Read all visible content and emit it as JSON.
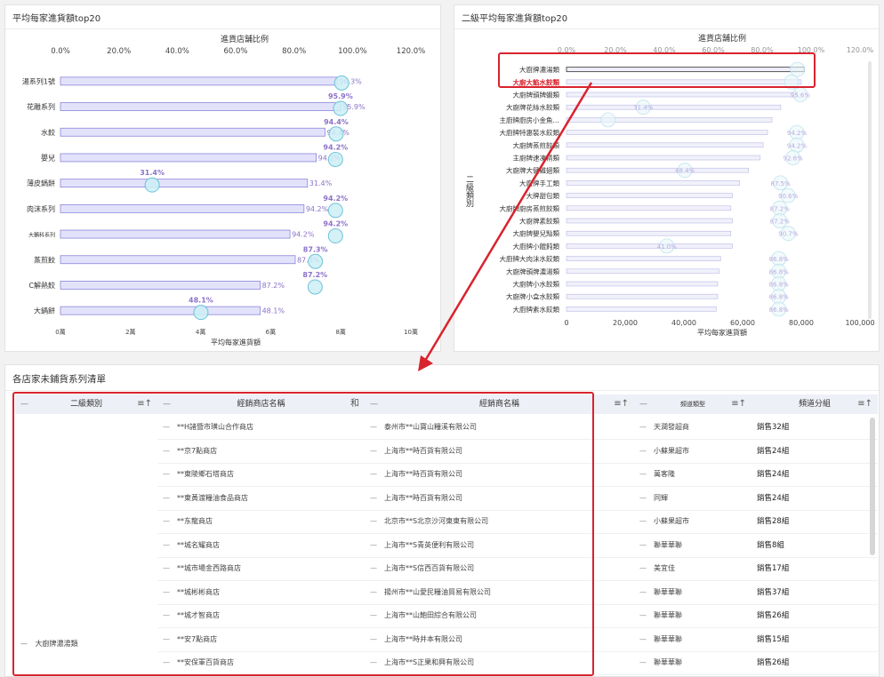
{
  "panel1": {
    "title": "平均每家進貨額top20",
    "top_axis_title": "進貨店舗比例",
    "top_ticks": [
      "0.0%",
      "20.0%",
      "40.0%",
      "60.0%",
      "80.0%",
      "100.0%",
      "120.0%"
    ],
    "bottom_ticks": [
      "0萬",
      "2萬",
      "4萬",
      "6萬",
      "8萬",
      "10萬"
    ],
    "bottom_axis_title": "平均每家進貨額"
  },
  "panel2": {
    "title": "二級平均每家進貨額top20",
    "top_axis_title": "進貨店舗比例",
    "top_ticks": [
      "0.0%",
      "20.0%",
      "40.0%",
      "60.0%",
      "80.0%",
      "100.0%",
      "120.0%"
    ],
    "bottom_ticks": [
      "0",
      "20,000",
      "40,000",
      "60,000",
      "80,000",
      "100,000"
    ],
    "bottom_axis_title": "平均每家進貨額",
    "y_axis_title": "二級類別"
  },
  "chart_data": [
    {
      "type": "bar",
      "title": "平均每家進貨額top20",
      "xlabel": "平均每家進貨額",
      "x2label": "進貨店舗比例",
      "categories": [
        "湯系列1號",
        "花雕系列",
        "水餃",
        "嬰兒",
        "薄皮鍋餅",
        "肉沫系列",
        "大鵝科系列",
        "蒸煎餃",
        "C解熱餃",
        "大鍋餅"
      ],
      "values_wan": [
        7.9,
        8.0,
        7.55,
        7.3,
        7.05,
        6.95,
        6.55,
        6.7,
        5.7,
        5.7
      ],
      "ratio_pct": [
        96.3,
        95.9,
        94.4,
        94.2,
        31.4,
        94.2,
        94.2,
        87.3,
        87.2,
        48.1
      ],
      "bar_labels": [
        "96.3%",
        "95.9%",
        "94.4%",
        "94.2%",
        "31.4%",
        "94.2%",
        "94.2%",
        "87.3%",
        "87.2%",
        "48.1%"
      ],
      "point_labels": [
        "95.9%",
        "94.4%",
        "94.2%",
        "31.4%",
        "94.2%",
        "94.2%",
        "87.3%",
        "87.2%",
        "48.1%"
      ],
      "xlim_wan": [
        0,
        10
      ],
      "x2lim_pct": [
        0,
        120
      ]
    },
    {
      "type": "bar",
      "title": "二級平均每家進貨額top20",
      "xlabel": "平均每家進貨額",
      "x2label": "進貨店舗比例",
      "ylabel": "二級類別",
      "categories": [
        "大廚牌濃湯類",
        "大廚大餡水餃類",
        "大廚牌頭牌蝦類",
        "大廚牌花絲水餃類",
        "主廚牌廚房小金魚…",
        "大廚牌特惠裝水餃類",
        "大廚牌蒸煎餃類",
        "主廚牌速凍精類",
        "大廚牌大健雞翅類",
        "大廚牌手工類",
        "大牌甜包類",
        "大廚牌廚房蒸煎餃類",
        "大廚牌素餃類",
        "大廚牌嬰兒點類",
        "大廚牌小餛飩類",
        "大廚牌大肉沫水餃類",
        "大廚牌頭牌濃湯類",
        "大廚牌小水餃類",
        "大廚牌小盒水餃類",
        "大廚牌素水餃類"
      ],
      "values": [
        81000,
        80000,
        78500,
        73000,
        70000,
        68500,
        67000,
        66000,
        62000,
        59000,
        56500,
        56000,
        56500,
        56000,
        56500,
        52500,
        52000,
        51500,
        51500,
        51000
      ],
      "ratio_pct": [
        94.4,
        92.0,
        95.6,
        31.4,
        17.0,
        94.2,
        94.2,
        92.6,
        48.4,
        87.5,
        90.6,
        87.2,
        87.2,
        90.7,
        41.0,
        86.8,
        86.8,
        86.8,
        86.8,
        86.8
      ],
      "point_labels": [
        "",
        "",
        "95.6%",
        "31.4%",
        "",
        "94.2%",
        "94.2%",
        "92.6%",
        "48.4%",
        "87.5%",
        "90.6%",
        "87.2%",
        "87.2%",
        "90.7%",
        "41.0%",
        "86.8%",
        "86.8%",
        "86.8%",
        "86.8%",
        "86.8%"
      ],
      "xlim": [
        0,
        100000
      ],
      "x2lim_pct": [
        0,
        120
      ]
    }
  ],
  "table": {
    "title": "各店家未鋪貨系列清單",
    "headers": [
      {
        "label": "二級類別",
        "sort": "≡↑"
      },
      {
        "label": "經銷商店名稱",
        "sort": "和"
      },
      {
        "label": "經銷商名稱",
        "sort": "≡↑"
      },
      {
        "label": "頻道類型",
        "sort": "≡↑"
      },
      {
        "label": "頻道分組",
        "sort": "≡↑"
      }
    ],
    "group_value": "大廚牌濃湯類",
    "rows": [
      {
        "store": "**H諸暨市璜山合作商店",
        "dealer": "泰州市**山寶山糧溪有限公司",
        "channel": "天潤發超商",
        "group": "銷售32組"
      },
      {
        "store": "**京7點商店",
        "dealer": "上海市**時百貨有限公司",
        "channel": "小蘇果超市",
        "group": "銷售24組"
      },
      {
        "store": "**東陵鄉石塔商店",
        "dealer": "上海市**時百貨有限公司",
        "channel": "萬客隆",
        "group": "銷售24組"
      },
      {
        "store": "**東黃渡糧油食品商店",
        "dealer": "上海市**時百貨有限公司",
        "channel": "同輝",
        "group": "銷售24組"
      },
      {
        "store": "**东龍商店",
        "dealer": "北京市**S北京沙河東東有限公司",
        "channel": "小蘇果超市",
        "group": "銷售28組"
      },
      {
        "store": "**城名耀商店",
        "dealer": "上海市**S青英便利有限公司",
        "channel": "聯華華聯",
        "group": "銷售8組"
      },
      {
        "store": "**城市場金西路商店",
        "dealer": "上海市**S信西百貨有限公司",
        "channel": "美宜佳",
        "group": "銷售17組"
      },
      {
        "store": "**城彬彬商店",
        "dealer": "揚州市**山愛民糧油貿易有限公司",
        "channel": "聯華華聯",
        "group": "銷售37組"
      },
      {
        "store": "**城才智商店",
        "dealer": "上海市**山鮑田綜合有限公司",
        "channel": "聯華華聯",
        "group": "銷售26組"
      },
      {
        "store": "**安7點商店",
        "dealer": "上海市**時井本有限公司",
        "channel": "聯華華聯",
        "group": "銷售15組"
      },
      {
        "store": "**安保軍百貨商店",
        "dealer": "上海市**S正果和興有限公司",
        "channel": "聯華華聯",
        "group": "銷售26組"
      }
    ]
  },
  "colors": {
    "bar_fill": "#e3e2fb",
    "bar_stroke": "#8a87d9",
    "point_fill": "#cdeff6",
    "point_stroke": "#6cc3d8",
    "label_purple": "#8b72c9",
    "highlight": "#d9232e"
  }
}
